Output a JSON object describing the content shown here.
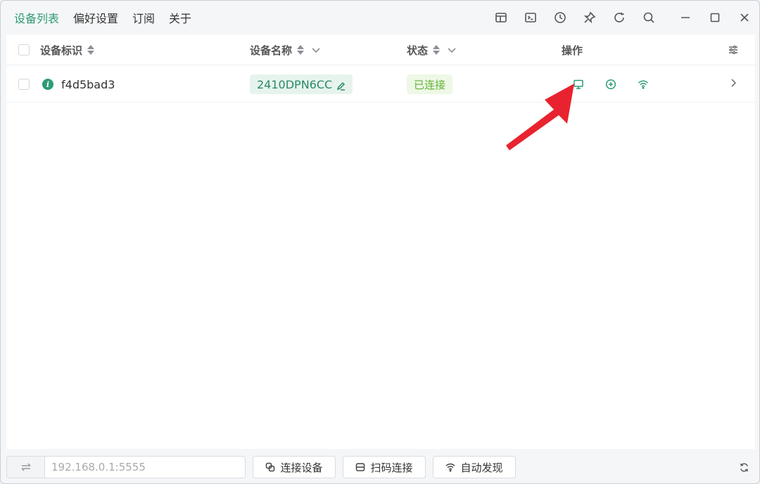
{
  "nav": {
    "items": [
      {
        "label": "设备列表",
        "active": true
      },
      {
        "label": "偏好设置",
        "active": false
      },
      {
        "label": "订阅",
        "active": false
      },
      {
        "label": "关于",
        "active": false
      }
    ]
  },
  "toolbar": {
    "icons": [
      "layout-icon",
      "terminal-icon",
      "history-icon",
      "pin-icon",
      "refresh-icon",
      "search-icon"
    ],
    "window_controls": [
      "minimize-icon",
      "maximize-icon",
      "close-icon"
    ]
  },
  "table": {
    "columns": {
      "id": "设备标识",
      "name": "设备名称",
      "status": "状态",
      "actions": "操作"
    },
    "rows": [
      {
        "id": "f4d5bad3",
        "name": "2410DPN6CC",
        "status": "已连接",
        "actions": [
          "monitor-icon",
          "add-circle-icon",
          "wifi-icon"
        ]
      }
    ]
  },
  "bottom": {
    "address_placeholder": "192.168.0.1:5555",
    "connect_label": "连接设备",
    "scan_label": "扫码连接",
    "discover_label": "自动发现"
  },
  "colors": {
    "accent": "#2d9b73",
    "status_green": "#62b235",
    "annotation_red": "#e8232f"
  }
}
